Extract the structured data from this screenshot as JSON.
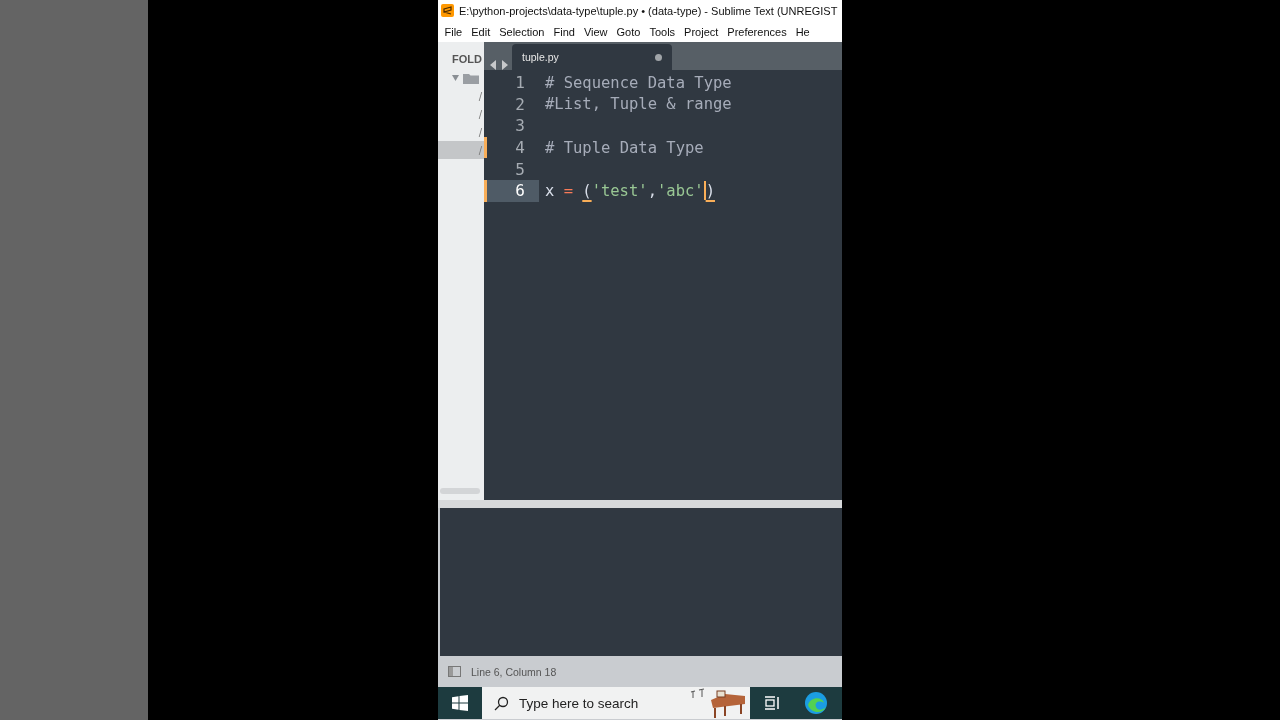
{
  "window": {
    "title": "E:\\python-projects\\data-type\\tuple.py • (data-type) - Sublime Text (UNREGIST"
  },
  "menu": [
    "File",
    "Edit",
    "Selection",
    "Find",
    "View",
    "Goto",
    "Tools",
    "Project",
    "Preferences",
    "He"
  ],
  "sidebar": {
    "header": "FOLD",
    "folder": {
      "expanded": true,
      "children": [
        {
          "label": "/",
          "selected": false
        },
        {
          "label": "/",
          "selected": false
        },
        {
          "label": "/",
          "selected": false
        },
        {
          "label": "/",
          "selected": true
        }
      ]
    }
  },
  "tabs": [
    {
      "label": "tuple.py",
      "selected": true,
      "dirty": true
    }
  ],
  "editor": {
    "lines": [
      {
        "number": "1",
        "current": false,
        "modified": false,
        "tokens": [
          {
            "kind": "comment",
            "text": "# Sequence Data Type"
          }
        ]
      },
      {
        "number": "2",
        "current": false,
        "modified": false,
        "tokens": [
          {
            "kind": "comment",
            "text": "#List, Tuple & range"
          }
        ]
      },
      {
        "number": "3",
        "current": false,
        "modified": false
      },
      {
        "number": "4",
        "current": false,
        "modified": true,
        "tokens": [
          {
            "kind": "comment",
            "text": "# Tuple Data Type"
          }
        ]
      },
      {
        "number": "5",
        "current": false,
        "modified": false
      },
      {
        "number": "6",
        "current": true,
        "modified": true,
        "tokens": [
          {
            "kind": "plain",
            "text": "x"
          },
          {
            "kind": "operator",
            "text": "="
          },
          {
            "kind": "bracket",
            "text": "("
          },
          {
            "kind": "string",
            "text": "'test'"
          },
          {
            "kind": "plain",
            "text": ","
          },
          {
            "kind": "string",
            "text": "'abc'"
          },
          {
            "kind": "bracket",
            "text": ")",
            "caret_before": true
          }
        ]
      }
    ]
  },
  "status_bar": {
    "text": "Line 6, Column 18"
  },
  "taskbar": {
    "search": {
      "placeholder": "Type here to search"
    }
  }
}
